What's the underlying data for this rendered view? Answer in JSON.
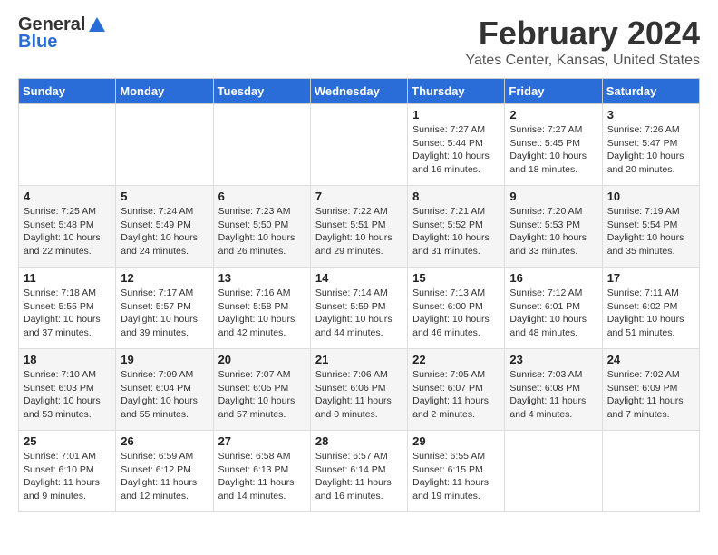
{
  "logo": {
    "general": "General",
    "blue": "Blue"
  },
  "title": "February 2024",
  "location": "Yates Center, Kansas, United States",
  "days_of_week": [
    "Sunday",
    "Monday",
    "Tuesday",
    "Wednesday",
    "Thursday",
    "Friday",
    "Saturday"
  ],
  "weeks": [
    [
      {
        "day": "",
        "info": ""
      },
      {
        "day": "",
        "info": ""
      },
      {
        "day": "",
        "info": ""
      },
      {
        "day": "",
        "info": ""
      },
      {
        "day": "1",
        "info": "Sunrise: 7:27 AM\nSunset: 5:44 PM\nDaylight: 10 hours\nand 16 minutes."
      },
      {
        "day": "2",
        "info": "Sunrise: 7:27 AM\nSunset: 5:45 PM\nDaylight: 10 hours\nand 18 minutes."
      },
      {
        "day": "3",
        "info": "Sunrise: 7:26 AM\nSunset: 5:47 PM\nDaylight: 10 hours\nand 20 minutes."
      }
    ],
    [
      {
        "day": "4",
        "info": "Sunrise: 7:25 AM\nSunset: 5:48 PM\nDaylight: 10 hours\nand 22 minutes."
      },
      {
        "day": "5",
        "info": "Sunrise: 7:24 AM\nSunset: 5:49 PM\nDaylight: 10 hours\nand 24 minutes."
      },
      {
        "day": "6",
        "info": "Sunrise: 7:23 AM\nSunset: 5:50 PM\nDaylight: 10 hours\nand 26 minutes."
      },
      {
        "day": "7",
        "info": "Sunrise: 7:22 AM\nSunset: 5:51 PM\nDaylight: 10 hours\nand 29 minutes."
      },
      {
        "day": "8",
        "info": "Sunrise: 7:21 AM\nSunset: 5:52 PM\nDaylight: 10 hours\nand 31 minutes."
      },
      {
        "day": "9",
        "info": "Sunrise: 7:20 AM\nSunset: 5:53 PM\nDaylight: 10 hours\nand 33 minutes."
      },
      {
        "day": "10",
        "info": "Sunrise: 7:19 AM\nSunset: 5:54 PM\nDaylight: 10 hours\nand 35 minutes."
      }
    ],
    [
      {
        "day": "11",
        "info": "Sunrise: 7:18 AM\nSunset: 5:55 PM\nDaylight: 10 hours\nand 37 minutes."
      },
      {
        "day": "12",
        "info": "Sunrise: 7:17 AM\nSunset: 5:57 PM\nDaylight: 10 hours\nand 39 minutes."
      },
      {
        "day": "13",
        "info": "Sunrise: 7:16 AM\nSunset: 5:58 PM\nDaylight: 10 hours\nand 42 minutes."
      },
      {
        "day": "14",
        "info": "Sunrise: 7:14 AM\nSunset: 5:59 PM\nDaylight: 10 hours\nand 44 minutes."
      },
      {
        "day": "15",
        "info": "Sunrise: 7:13 AM\nSunset: 6:00 PM\nDaylight: 10 hours\nand 46 minutes."
      },
      {
        "day": "16",
        "info": "Sunrise: 7:12 AM\nSunset: 6:01 PM\nDaylight: 10 hours\nand 48 minutes."
      },
      {
        "day": "17",
        "info": "Sunrise: 7:11 AM\nSunset: 6:02 PM\nDaylight: 10 hours\nand 51 minutes."
      }
    ],
    [
      {
        "day": "18",
        "info": "Sunrise: 7:10 AM\nSunset: 6:03 PM\nDaylight: 10 hours\nand 53 minutes."
      },
      {
        "day": "19",
        "info": "Sunrise: 7:09 AM\nSunset: 6:04 PM\nDaylight: 10 hours\nand 55 minutes."
      },
      {
        "day": "20",
        "info": "Sunrise: 7:07 AM\nSunset: 6:05 PM\nDaylight: 10 hours\nand 57 minutes."
      },
      {
        "day": "21",
        "info": "Sunrise: 7:06 AM\nSunset: 6:06 PM\nDaylight: 11 hours\nand 0 minutes."
      },
      {
        "day": "22",
        "info": "Sunrise: 7:05 AM\nSunset: 6:07 PM\nDaylight: 11 hours\nand 2 minutes."
      },
      {
        "day": "23",
        "info": "Sunrise: 7:03 AM\nSunset: 6:08 PM\nDaylight: 11 hours\nand 4 minutes."
      },
      {
        "day": "24",
        "info": "Sunrise: 7:02 AM\nSunset: 6:09 PM\nDaylight: 11 hours\nand 7 minutes."
      }
    ],
    [
      {
        "day": "25",
        "info": "Sunrise: 7:01 AM\nSunset: 6:10 PM\nDaylight: 11 hours\nand 9 minutes."
      },
      {
        "day": "26",
        "info": "Sunrise: 6:59 AM\nSunset: 6:12 PM\nDaylight: 11 hours\nand 12 minutes."
      },
      {
        "day": "27",
        "info": "Sunrise: 6:58 AM\nSunset: 6:13 PM\nDaylight: 11 hours\nand 14 minutes."
      },
      {
        "day": "28",
        "info": "Sunrise: 6:57 AM\nSunset: 6:14 PM\nDaylight: 11 hours\nand 16 minutes."
      },
      {
        "day": "29",
        "info": "Sunrise: 6:55 AM\nSunset: 6:15 PM\nDaylight: 11 hours\nand 19 minutes."
      },
      {
        "day": "",
        "info": ""
      },
      {
        "day": "",
        "info": ""
      }
    ]
  ]
}
